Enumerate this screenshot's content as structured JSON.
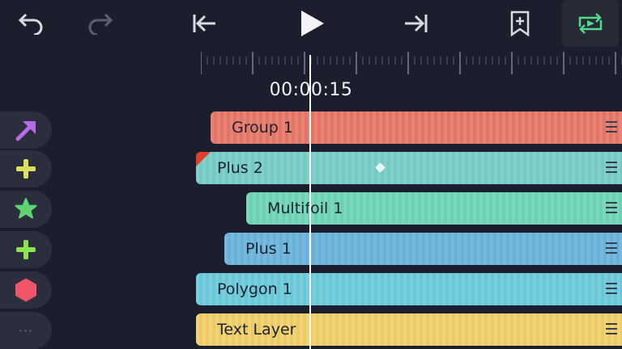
{
  "toolbar": {
    "undo_icon": "undo-arrow-icon",
    "redo_icon": "redo-arrow-icon",
    "jump_start_icon": "skip-to-start-icon",
    "play_icon": "play-icon",
    "jump_end_icon": "skip-to-end-icon",
    "bookmark_icon": "add-bookmark-icon",
    "loop_icon": "loop-playback-icon",
    "loop_active": true
  },
  "timeline": {
    "current_time": "00:00:15"
  },
  "layers": [
    {
      "name": "Group 1",
      "color": "#e87a6a",
      "icon": "arrow-icon",
      "icon_color": "#b56ae8"
    },
    {
      "name": "Plus 2",
      "color": "#79cdc8",
      "icon": "plus-icon",
      "icon_color": "#dde05a",
      "keyframe": true,
      "flag": true
    },
    {
      "name": "Multifoil 1",
      "color": "#72d6b8",
      "icon": "star-icon",
      "icon_color": "#5fd36f"
    },
    {
      "name": "Plus 1",
      "color": "#6db6de",
      "icon": "plus-icon",
      "icon_color": "#8be34f"
    },
    {
      "name": "Polygon 1",
      "color": "#6ecbdc",
      "icon": "hexagon-icon",
      "icon_color": "#f0556a"
    },
    {
      "name": "Text Layer",
      "color": "#f2d06b",
      "icon": "more-icon",
      "icon_color": "#6a6e7c"
    }
  ],
  "colors": {
    "background": "#1b1e2c",
    "playhead": "#ffffff",
    "loop_accent": "#53d98a"
  }
}
